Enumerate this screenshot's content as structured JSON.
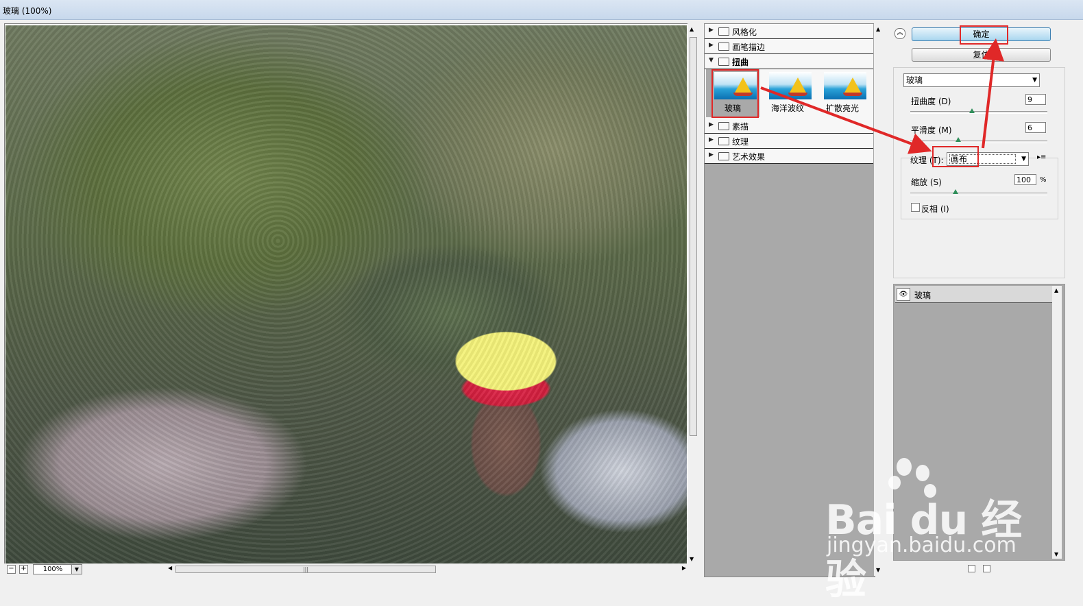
{
  "window": {
    "title": "玻璃 (100%)"
  },
  "preview": {
    "zoom": "100%"
  },
  "filter_categories": [
    {
      "label": "风格化",
      "expanded": false
    },
    {
      "label": "画笔描边",
      "expanded": false
    },
    {
      "label": "扭曲",
      "expanded": true
    },
    {
      "label": "素描",
      "expanded": false
    },
    {
      "label": "纹理",
      "expanded": false
    },
    {
      "label": "艺术效果",
      "expanded": false
    }
  ],
  "distort_filters": [
    {
      "label": "玻璃",
      "selected": true
    },
    {
      "label": "海洋波纹",
      "selected": false
    },
    {
      "label": "扩散亮光",
      "selected": false
    }
  ],
  "buttons": {
    "ok": "确定",
    "reset": "复位"
  },
  "filter_select": {
    "value": "玻璃"
  },
  "params": {
    "distortion": {
      "label": "扭曲度 (D)",
      "value": "9",
      "level": 0.45
    },
    "smoothness": {
      "label": "平滑度 (M)",
      "value": "6",
      "level": 0.35
    },
    "texture": {
      "label": "纹理 (T):",
      "value": "画布"
    },
    "scaling": {
      "label": "缩放 (S)",
      "value": "100",
      "unit": "%",
      "level": 0.33
    },
    "invert": {
      "label": "反相 (I)",
      "checked": false
    }
  },
  "layers": [
    {
      "label": "玻璃",
      "visible": true
    }
  ],
  "watermark": {
    "brand": "Bai du 经验",
    "url": "jingyan.baidu.com"
  },
  "colors": {
    "highlight": "#e02828",
    "ok_button": "#a9d6ef"
  }
}
